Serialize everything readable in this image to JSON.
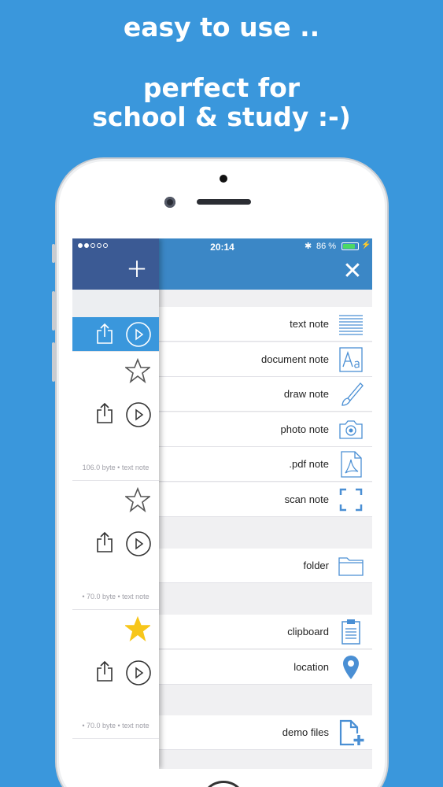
{
  "promo": {
    "line1": "easy to use ..",
    "line2": "perfect for",
    "line3": "school & study :-)"
  },
  "status_bar": {
    "time": "20:14",
    "battery": "86 %",
    "battery_level": 0.86
  },
  "menu": {
    "items": [
      {
        "label": "text note",
        "icon": "lines-icon"
      },
      {
        "label": "document note",
        "icon": "font-icon"
      },
      {
        "label": "draw note",
        "icon": "brush-icon"
      },
      {
        "label": "photo note",
        "icon": "camera-icon"
      },
      {
        "label": ".pdf note",
        "icon": "pdf-icon"
      },
      {
        "label": "scan note",
        "icon": "scan-icon"
      },
      {
        "label": "folder",
        "icon": "folder-icon"
      },
      {
        "label": "clipboard",
        "icon": "clipboard-icon"
      },
      {
        "label": "location",
        "icon": "location-pin-icon"
      },
      {
        "label": "demo files",
        "icon": "add-file-icon"
      }
    ]
  },
  "drawer": {
    "notes": [
      {
        "meta": "106.0 byte • text note",
        "starred": false
      },
      {
        "meta": "• 70.0 byte • text note",
        "starred": false
      },
      {
        "meta": "• 70.0 byte • text note",
        "starred": true
      }
    ]
  },
  "colors": {
    "background": "#3a97dc",
    "header_blue": "#3b87c6",
    "drawer_header": "#3b5a94",
    "icon_blue": "#4a8fd4",
    "star_gold": "#f7c61a"
  }
}
